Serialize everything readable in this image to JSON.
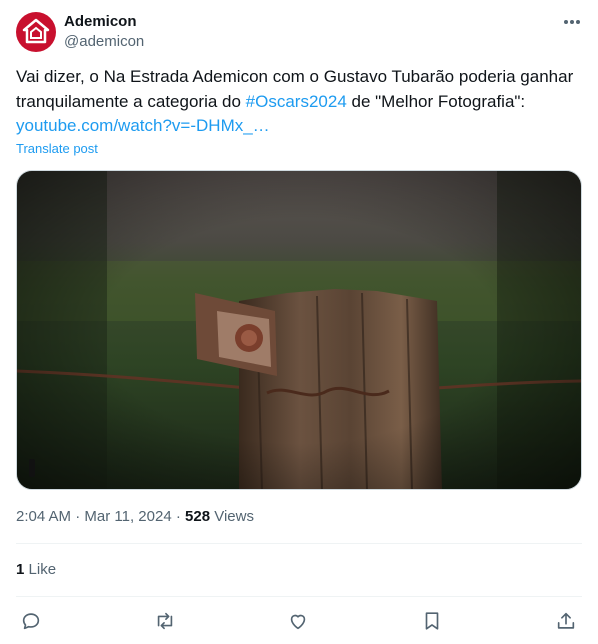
{
  "author": {
    "display_name": "Ademicon",
    "handle": "@ademicon"
  },
  "post": {
    "text_before": "Vai dizer, o Na Estrada Ademicon com o Gustavo Tubarão poderia ganhar tranquilamente a categoria do ",
    "hashtag": "#Oscars2024",
    "text_after": " de \"Melhor Fotografia\":  ",
    "link": "youtube.com/watch?v=-DHMx_…",
    "translate_label": "Translate post"
  },
  "meta": {
    "time": "2:04 AM",
    "separator1": "·",
    "date": "Mar 11, 2024",
    "separator2": "·",
    "views_count": "528",
    "views_label": "Views"
  },
  "likes": {
    "count": "1",
    "label": "Like"
  },
  "colors": {
    "brand": "#c8102e",
    "accent": "#1d9bf0",
    "secondary_text": "#536471"
  },
  "icons": [
    "more-icon",
    "reply-icon",
    "retweet-icon",
    "like-icon",
    "bookmark-icon",
    "share-icon"
  ]
}
